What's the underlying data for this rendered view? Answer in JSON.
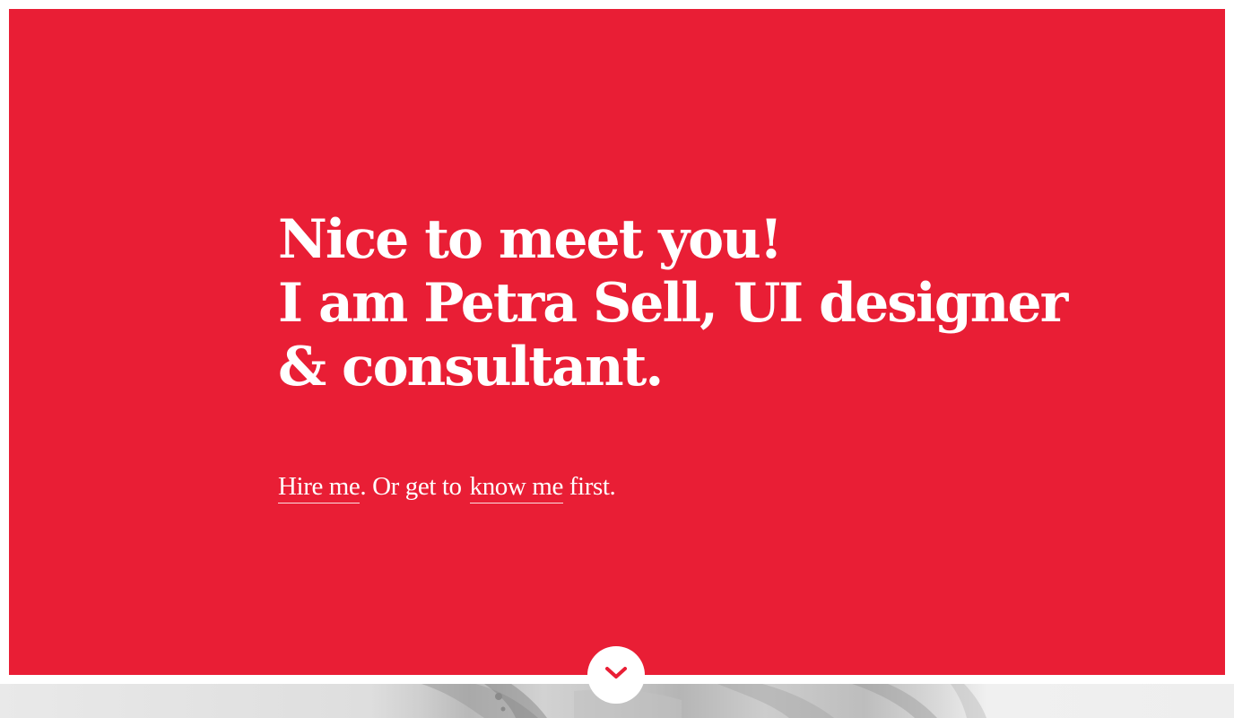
{
  "colors": {
    "accent": "#e91e35",
    "text_on_accent": "#ffffff",
    "background": "#ffffff"
  },
  "hero": {
    "headline_lines": [
      "Nice to meet you!",
      "I am Petra Sell, UI designer",
      "& consultant."
    ],
    "tagline": {
      "hire_link": "Hire me",
      "middle_text": ". Or get to",
      "know_link": "know me",
      "end_text": " first."
    }
  },
  "scroll_button": {
    "icon": "chevron-down-icon"
  },
  "photo": {
    "description_icon": "portrait-photo"
  }
}
